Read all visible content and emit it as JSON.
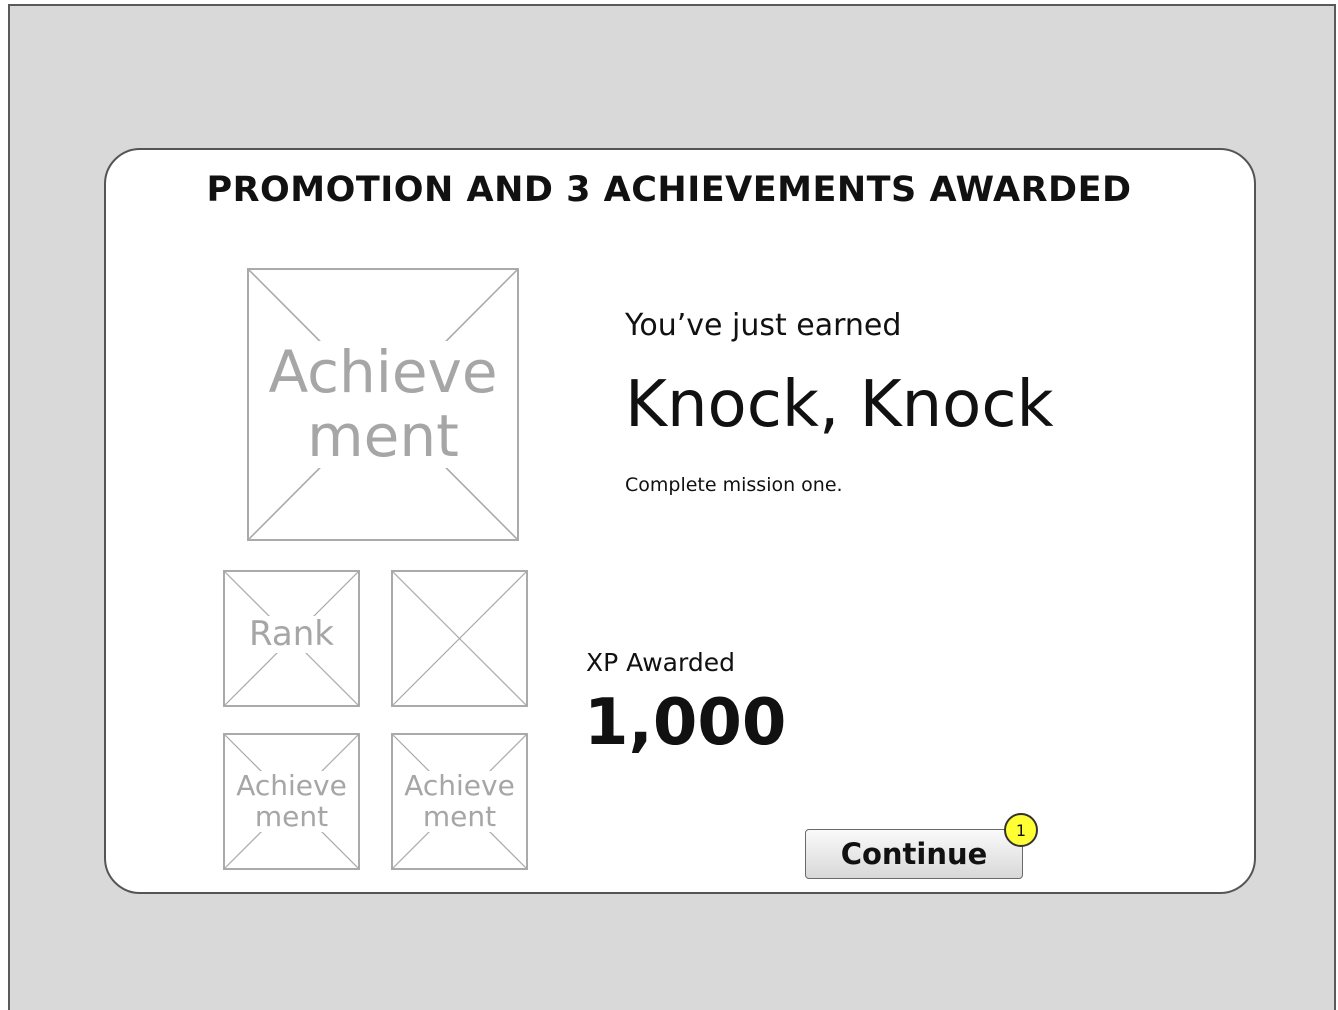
{
  "dialog": {
    "title": "PROMOTION AND 3 ACHIEVEMENTS AWARDED",
    "main_image_label": "Achieve\nment",
    "thumbnails": {
      "rank_label": "Rank",
      "achievement_1_label": "Achieve\nment",
      "achievement_2_label": "Achieve\nment"
    },
    "earned_prefix": "You’ve just earned",
    "achievement_name": "Knock, Knock",
    "achievement_description": "Complete mission one.",
    "xp_label": "XP Awarded",
    "xp_value": "1,000",
    "continue_label": "Continue",
    "annotation_marker": "1"
  }
}
